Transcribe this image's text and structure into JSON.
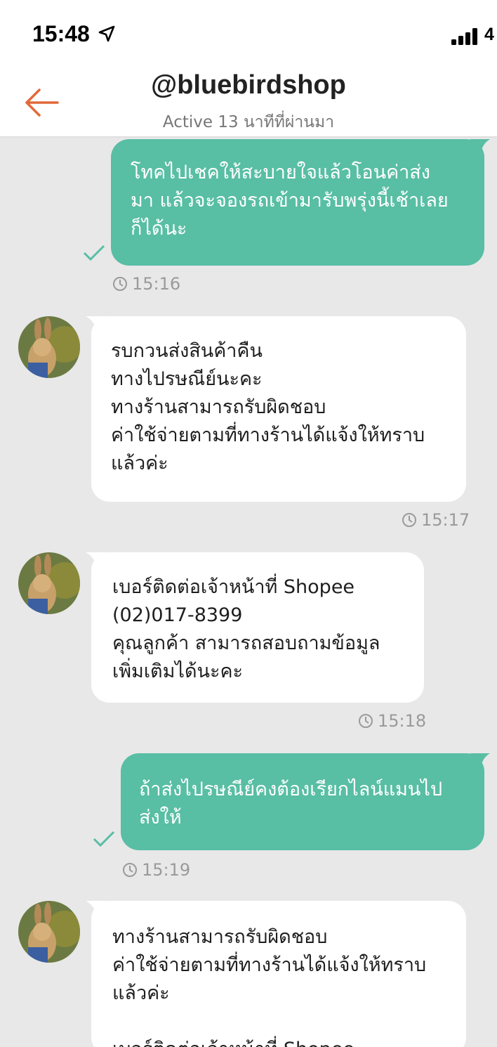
{
  "status_bar": {
    "time": "15:48",
    "network": "4"
  },
  "header": {
    "title": "@bluebirdshop",
    "subtitle": "Active 13 นาทีที่ผ่านมา"
  },
  "messages": [
    {
      "direction": "outgoing",
      "lines": [
        "โทคไปเชคให้สะบายใจแล้วโอนค่าส่ง",
        "มา แล้วจะจองรถเข้ามารับพรุ่งนี้เช้าเลย",
        "ก็ได้นะ"
      ],
      "time": "15:16",
      "read": true
    },
    {
      "direction": "incoming",
      "lines": [
        "รบกวนส่งสินค้าคืน",
        "ทางไปรษณีย์นะคะ",
        "ทางร้านสามารถรับผิดชอบ",
        "ค่าใช้จ่ายตามที่ทางร้านได้แจ้งให้ทราบ",
        "แล้วค่ะ"
      ],
      "time": "15:17"
    },
    {
      "direction": "incoming",
      "lines": [
        "เบอร์ติดต่อเจ้าหน้าที่ Shopee",
        "(02)017-8399",
        "คุณลูกค้า สามารถสอบถามข้อมูล",
        "เพิ่มเติมได้นะคะ"
      ],
      "time": "15:18"
    },
    {
      "direction": "outgoing",
      "lines": [
        "ถ้าส่งไปรษณีย์คงต้องเรียกไลน์แมนไป",
        "ส่งให้"
      ],
      "time": "15:19",
      "read": true
    },
    {
      "direction": "incoming",
      "lines": [
        "ทางร้านสามารถรับผิดชอบ",
        "ค่าใช้จ่ายตามที่ทางร้านได้แจ้งให้ทราบ",
        "แล้วค่ะ",
        "",
        "เบอร์ติดต่อเจ้าหน้าที่ Shopee"
      ]
    }
  ],
  "colors": {
    "outgoing_bubble": "#58bea4",
    "incoming_bubble": "#ffffff",
    "chat_background": "#e8e8e8",
    "accent_back_arrow": "#e2693a"
  },
  "icons": {
    "back": "arrow-left-icon",
    "location": "location-arrow-icon",
    "signal": "signal-bars-icon",
    "read": "checkmark-icon",
    "time": "clock-icon"
  }
}
